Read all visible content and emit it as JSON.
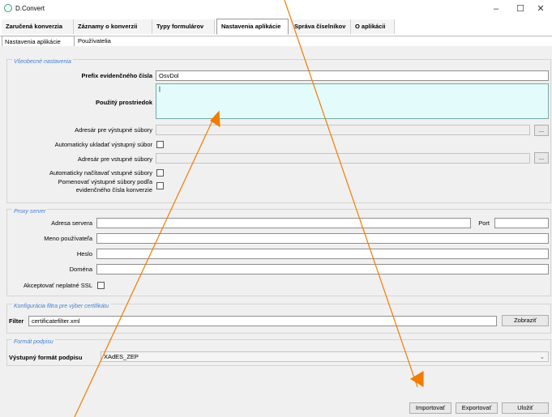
{
  "window": {
    "title": "D.Convert",
    "minimize": "–",
    "maximize": "☐",
    "close": "✕"
  },
  "tabs": [
    "Zaručená konverzia",
    "Záznamy o konverzii",
    "Typy formulárov",
    "Nastavenia aplikácie",
    "Správa číselníkov",
    "O aplikácii"
  ],
  "subtabs": [
    "Nastavenia aplikácie",
    "Používatelia"
  ],
  "general": {
    "title": "Všeobecné nastavenia",
    "prefix_label": "Prefix evidenčného čísla",
    "prefix_value": "OsvDol",
    "tool_label": "Použitý prostriedok",
    "tool_value": "|",
    "outdir_label": "Adresár pre výstupné súbory",
    "autosave_label": "Automaticky ukladať výstupný súbor",
    "indir_label": "Adresár pre vstupné súbory",
    "autoload_label": "Automaticky načítavať vstupné súbory",
    "rename_label_1": "Pomenovať výstupné súbory podľa",
    "rename_label_2": "evidenčného čísla konverzie",
    "browse": "..."
  },
  "proxy": {
    "title": "Proxy server",
    "address_label": "Adresa servera",
    "port_label": "Port",
    "user_label": "Meno používateľa",
    "password_label": "Heslo",
    "domain_label": "Doména",
    "ssl_label": "Akceptovať neplatné SSL"
  },
  "cert": {
    "title": "Konfigurácia filtra pre výber certifikátu",
    "filter_label": "Filter",
    "filter_value": "certificatefilter.xml",
    "show_button": "Zobraziť"
  },
  "signature": {
    "title": "Formát podpisu",
    "format_label": "Výstupný formát podpisu",
    "format_value": "XAdES_ZEP"
  },
  "footer": {
    "import": "Importovať",
    "export": "Exportovať",
    "save": "Uložiť"
  },
  "colors": {
    "annotation": "#f07d00",
    "group_title": "#4a7fd0",
    "highlight_field": "#e3fbfb"
  }
}
